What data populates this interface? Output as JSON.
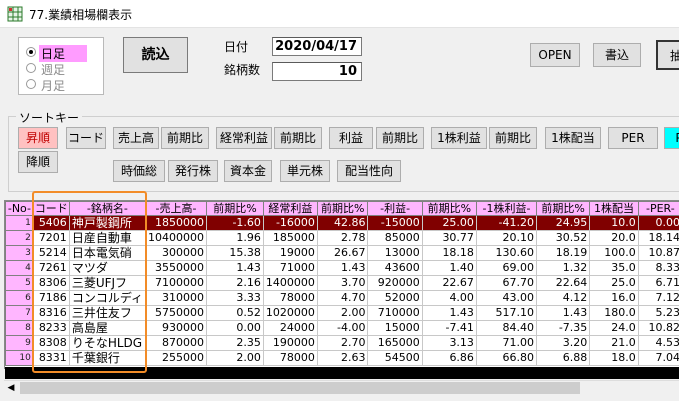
{
  "window": {
    "title": "77.業績相場欄表示",
    "icon": "grid-app-icon"
  },
  "period": {
    "options": [
      {
        "label": "日足",
        "selected": true
      },
      {
        "label": "週足",
        "selected": false
      },
      {
        "label": "月足",
        "selected": false
      }
    ]
  },
  "top": {
    "load_label": "読込",
    "date_label": "日付",
    "date_value": "2020/04/17",
    "count_label": "銘柄数",
    "count_value": "10",
    "open_label": "OPEN",
    "write_label": "書込",
    "extract_label": "抽"
  },
  "sort": {
    "title": "ソートキー",
    "asc_label": "昇順",
    "desc_label": "降順",
    "row1": [
      "コード",
      "売上高",
      "前期比",
      "経常利益",
      "前期比",
      "利益",
      "前期比",
      "1株利益",
      "前期比",
      "1株配当",
      "PER",
      "P"
    ],
    "row2": [
      "時価総",
      "発行株",
      "資本金",
      "単元株",
      "配当性向"
    ]
  },
  "grid": {
    "headers": [
      "-No-",
      "コード",
      "-銘柄名-",
      "-売上高-",
      "前期比%",
      "経常利益",
      "前期比%",
      "-利益-",
      "前期比%",
      "-1株利益-",
      "前期比%",
      "1株配当",
      "-PER-"
    ],
    "rows": [
      [
        "1",
        "5406",
        "神戸製鋼所",
        "1850000",
        "-1.60",
        "-16000",
        "42.86",
        "-15000",
        "25.00",
        "-41.20",
        "24.95",
        "10.0",
        "0.00"
      ],
      [
        "2",
        "7201",
        "日産自動車",
        "10400000",
        "1.96",
        "185000",
        "2.78",
        "85000",
        "30.77",
        "20.10",
        "30.52",
        "20.0",
        "18.14"
      ],
      [
        "3",
        "5214",
        "日本電気硝",
        "300000",
        "15.38",
        "19000",
        "26.67",
        "13000",
        "18.18",
        "130.60",
        "18.19",
        "100.0",
        "10.87"
      ],
      [
        "4",
        "7261",
        "マツダ",
        "3550000",
        "1.43",
        "71000",
        "1.43",
        "43600",
        "1.40",
        "69.00",
        "1.32",
        "35.0",
        "8.33"
      ],
      [
        "5",
        "8306",
        "三菱UFJフ",
        "7100000",
        "2.16",
        "1400000",
        "3.70",
        "920000",
        "22.67",
        "67.70",
        "22.64",
        "25.0",
        "6.71"
      ],
      [
        "6",
        "7186",
        "コンコルディ",
        "310000",
        "3.33",
        "78000",
        "4.70",
        "52000",
        "4.00",
        "43.00",
        "4.12",
        "16.0",
        "7.12"
      ],
      [
        "7",
        "8316",
        "三井住友フ",
        "5750000",
        "0.52",
        "1020000",
        "2.00",
        "710000",
        "1.43",
        "517.10",
        "1.43",
        "180.0",
        "5.23"
      ],
      [
        "8",
        "8233",
        "高島屋",
        "930000",
        "0.00",
        "24000",
        "-4.00",
        "15000",
        "-7.41",
        "84.40",
        "-7.35",
        "24.0",
        "10.82"
      ],
      [
        "9",
        "8308",
        "りそなHLDG",
        "870000",
        "2.35",
        "190000",
        "2.70",
        "165000",
        "3.13",
        "71.00",
        "3.20",
        "21.0",
        "4.53"
      ],
      [
        "10",
        "8331",
        "千葉銀行",
        "255000",
        "2.00",
        "78000",
        "2.63",
        "54500",
        "6.86",
        "66.80",
        "6.88",
        "18.0",
        "7.04"
      ]
    ]
  },
  "colors": {
    "header_bg": "#ffb6ff",
    "selected_row_bg": "#800000",
    "annotation": "#f28c28",
    "sort_asc_bg": "#ffc1c1"
  }
}
